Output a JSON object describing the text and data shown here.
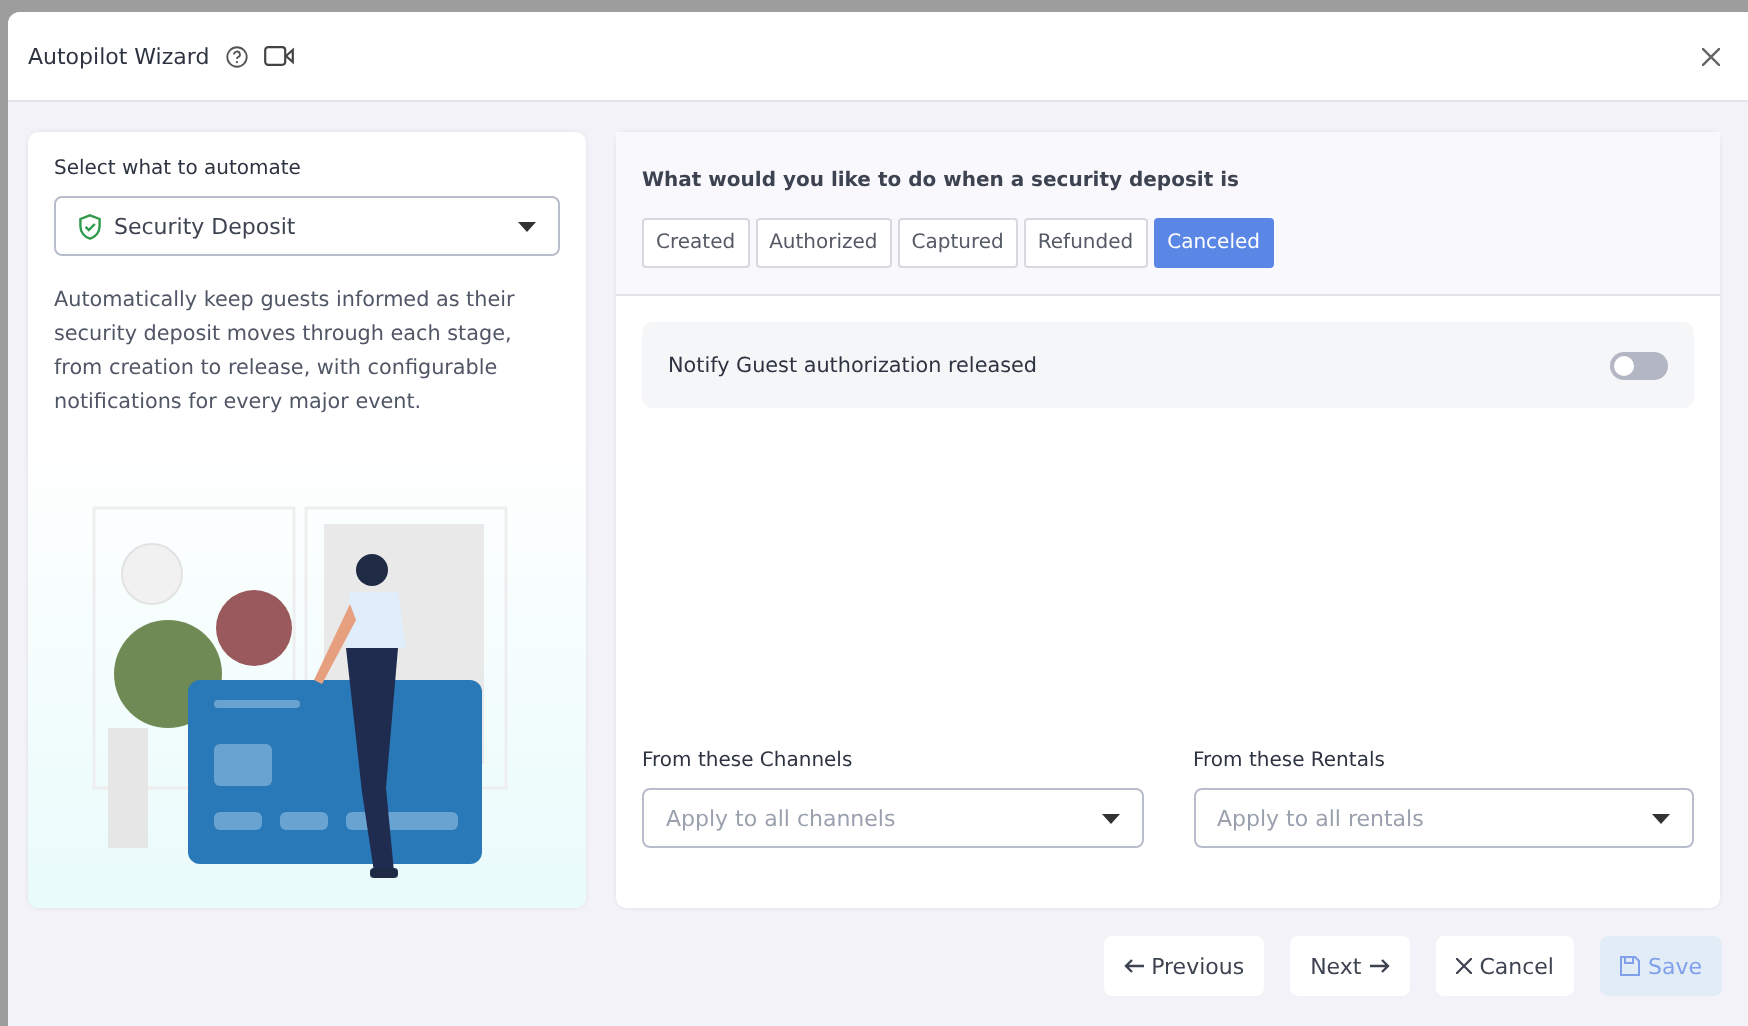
{
  "window": {
    "title": "Autopilot Wizard"
  },
  "left": {
    "label": "Select what to automate",
    "select": {
      "value": "Security Deposit"
    },
    "description": "Automatically keep guests informed as their security deposit moves through each stage, from creation to release, with configurable notifications for every major event."
  },
  "right": {
    "question": "What would you like to do when a security deposit is",
    "tabs": [
      {
        "label": "Created",
        "selected": false
      },
      {
        "label": "Authorized",
        "selected": false
      },
      {
        "label": "Captured",
        "selected": false
      },
      {
        "label": "Refunded",
        "selected": false
      },
      {
        "label": "Canceled",
        "selected": true
      }
    ],
    "notifications": [
      {
        "label": "Notify Guest authorization released",
        "on": false
      }
    ],
    "filters": [
      {
        "label": "From these Channels",
        "placeholder": "Apply to all channels"
      },
      {
        "label": "From these Rentals",
        "placeholder": "Apply to all rentals"
      }
    ]
  },
  "footer": [
    {
      "kind": "previous",
      "label": "Previous",
      "disabled": false
    },
    {
      "kind": "next",
      "label": "Next",
      "disabled": false
    },
    {
      "kind": "cancel",
      "label": "Cancel",
      "disabled": false
    },
    {
      "kind": "save",
      "label": "Save",
      "disabled": true
    }
  ]
}
